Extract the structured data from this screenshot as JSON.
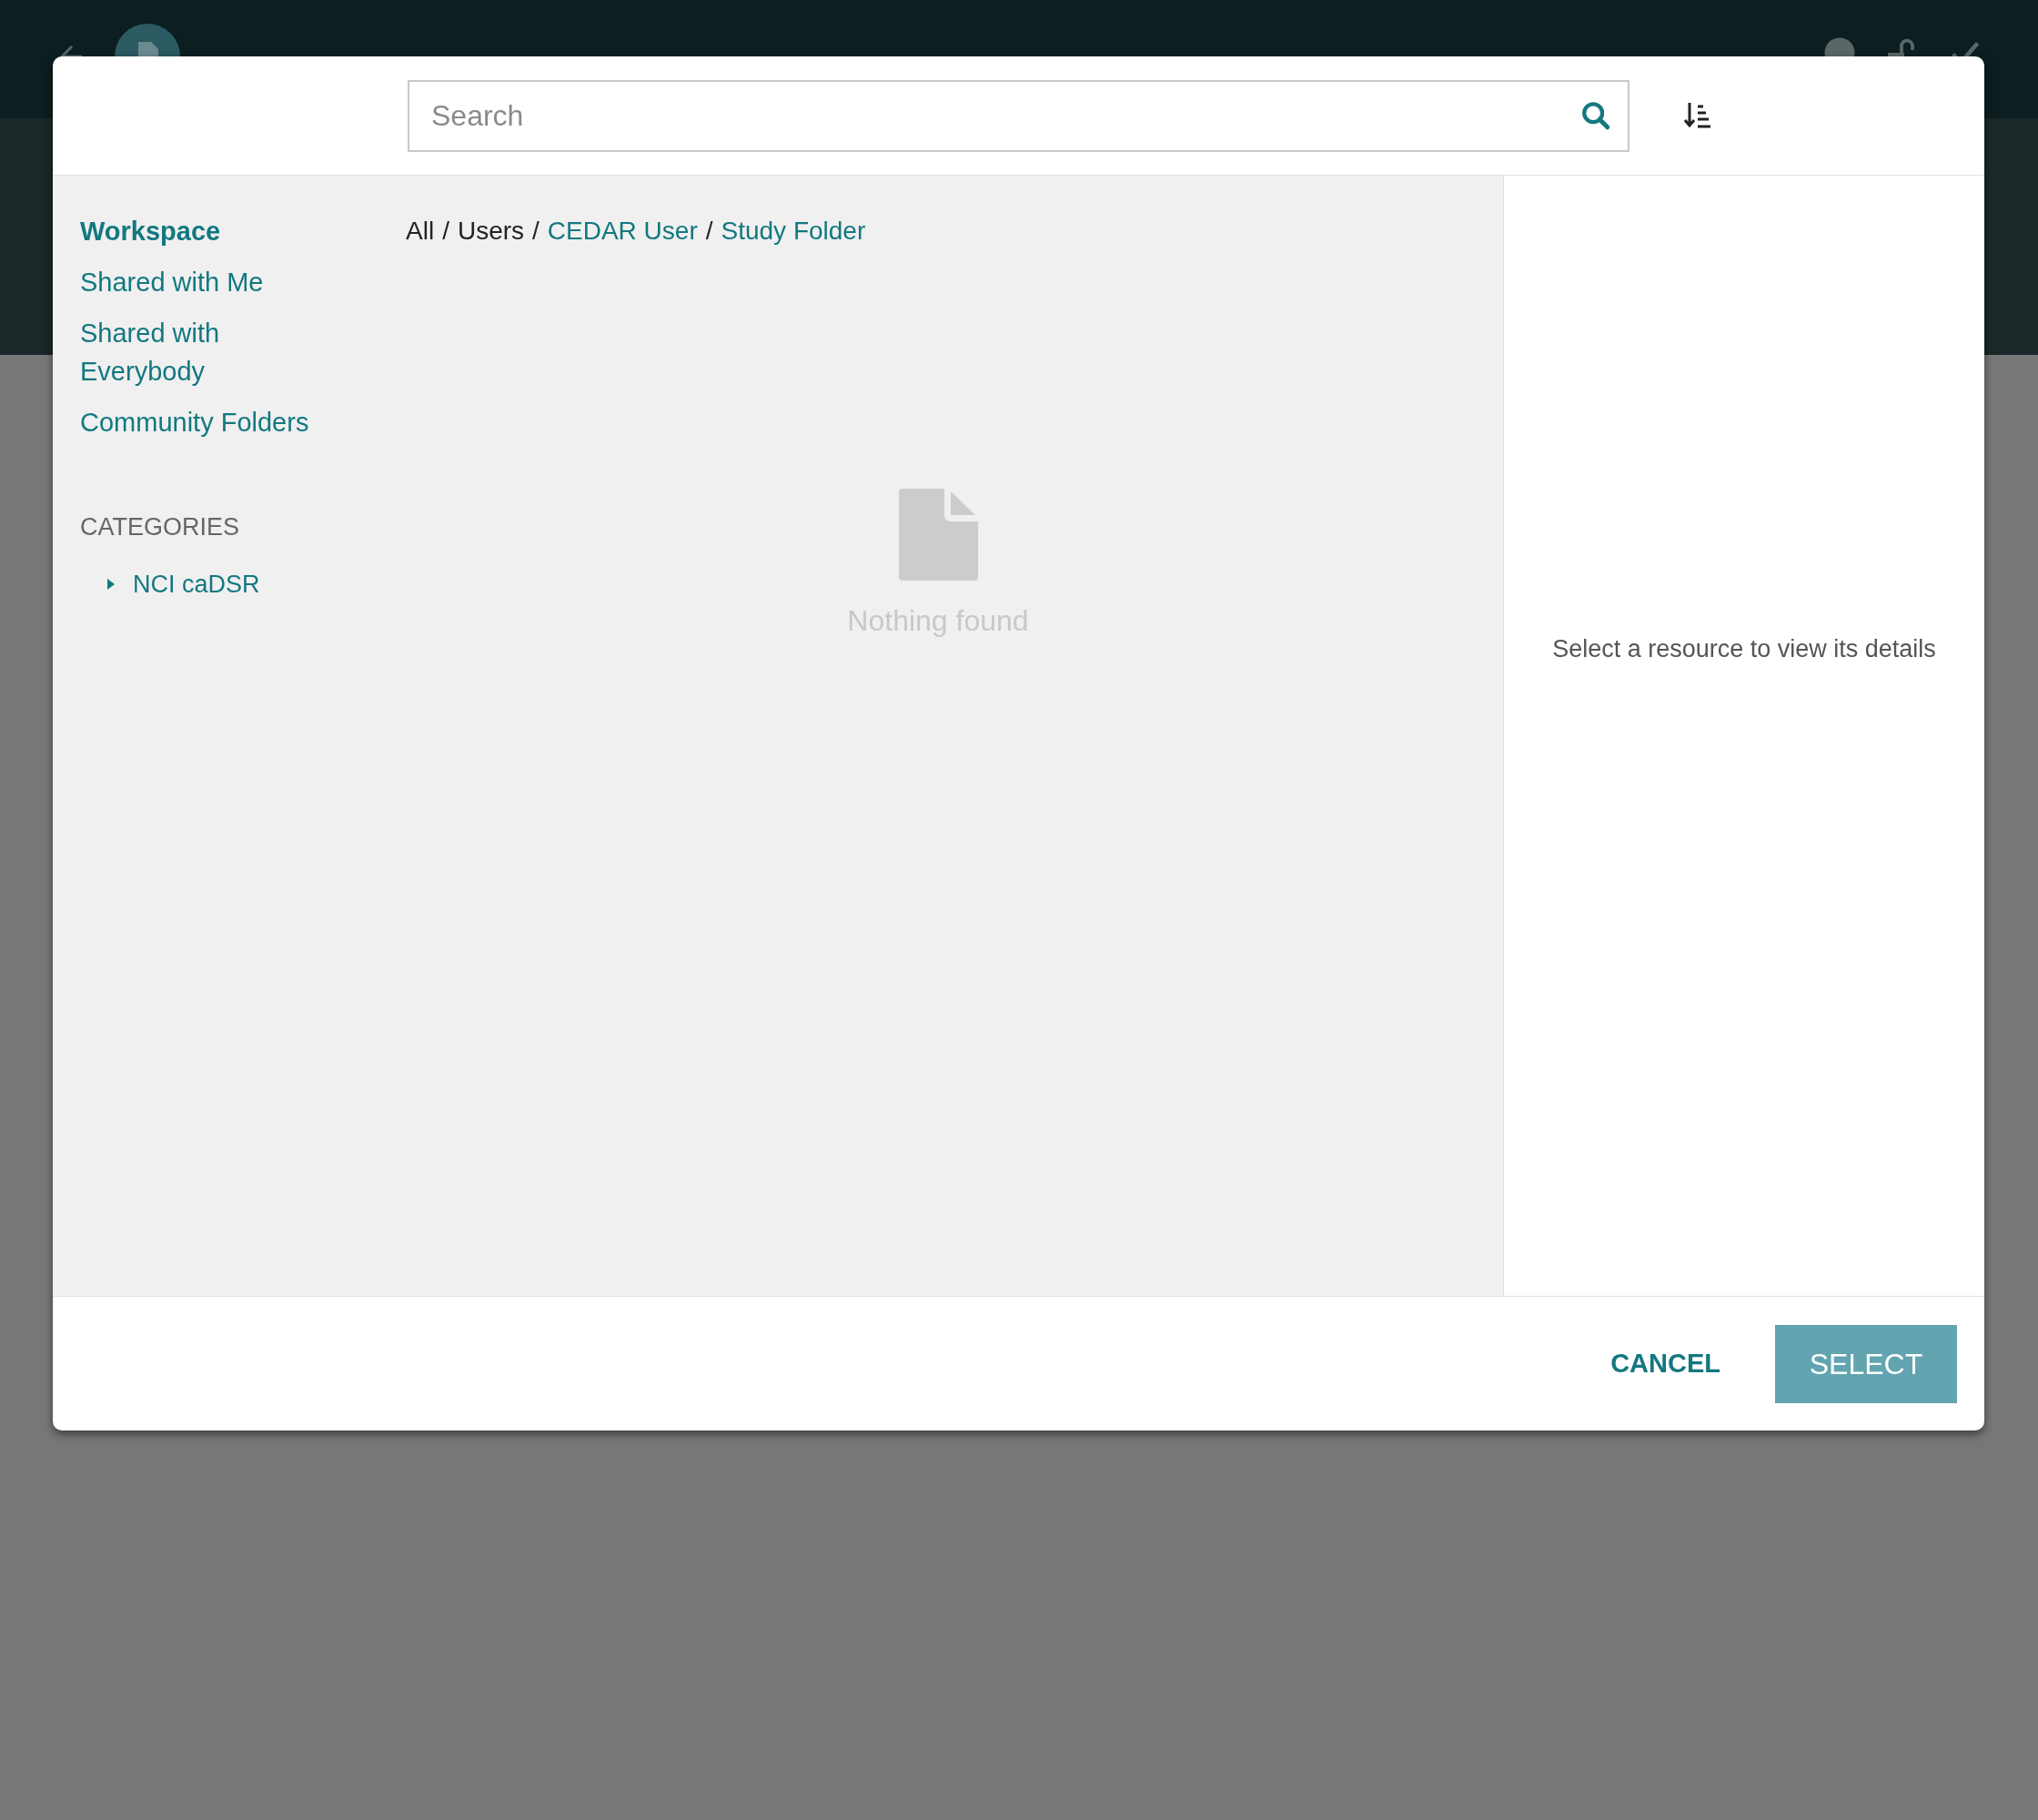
{
  "dialog": {
    "search": {
      "placeholder": "Search"
    },
    "sidebar": {
      "items": [
        {
          "label": "Workspace",
          "selected": true
        },
        {
          "label": "Shared with Me",
          "selected": false
        },
        {
          "label": "Shared with Everybody",
          "selected": false
        },
        {
          "label": "Community Folders",
          "selected": false
        }
      ],
      "categories_heading": "CATEGORIES",
      "categories": [
        {
          "label": "NCI caDSR",
          "expanded": false
        }
      ]
    },
    "breadcrumb": [
      {
        "label": "All",
        "kind": "plain"
      },
      {
        "label": "/",
        "kind": "separator"
      },
      {
        "label": "Users",
        "kind": "plain"
      },
      {
        "label": "/",
        "kind": "separator"
      },
      {
        "label": "CEDAR User",
        "kind": "link"
      },
      {
        "label": "/",
        "kind": "separator"
      },
      {
        "label": "Study Folder",
        "kind": "link"
      }
    ],
    "empty_message": "Nothing found",
    "details_message": "Select a resource to view its details",
    "buttons": [
      {
        "label": "CANCEL",
        "kind": "flat"
      },
      {
        "label": "SELECT",
        "kind": "raised"
      }
    ]
  }
}
